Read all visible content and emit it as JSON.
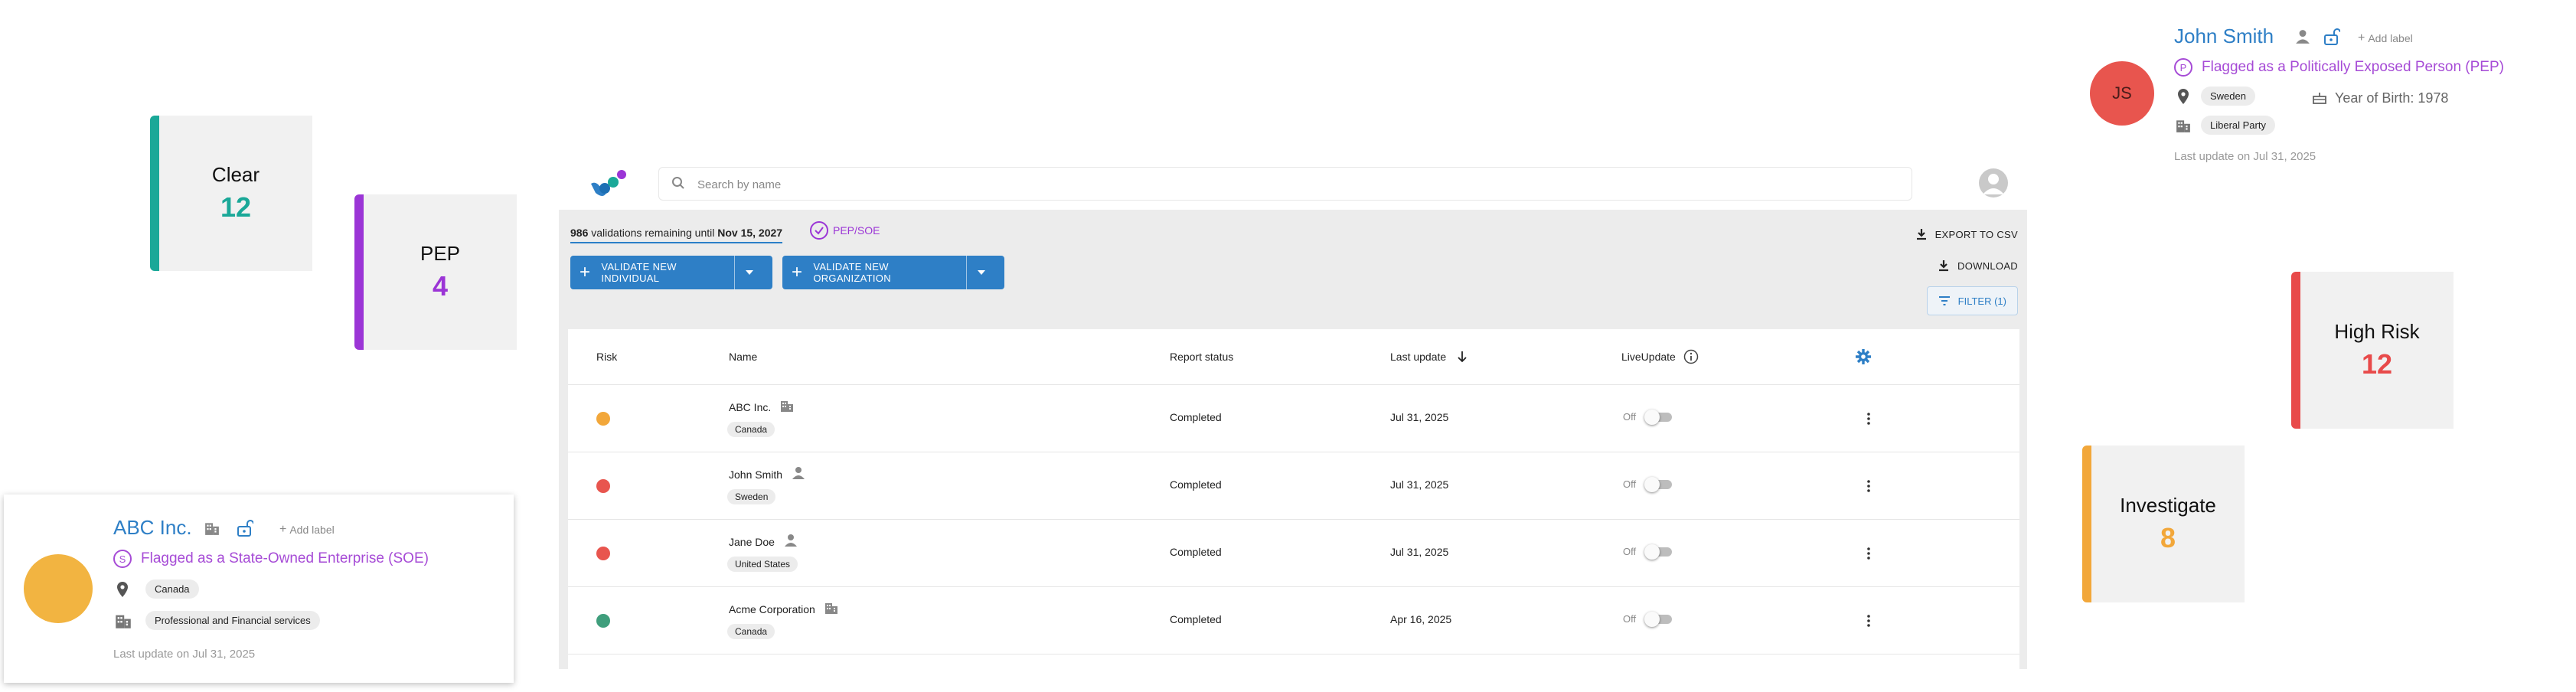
{
  "stats": [
    {
      "label": "Clear",
      "value": "12",
      "color": "#1aa898"
    },
    {
      "label": "PEP",
      "value": "4",
      "color": "#9b35d6"
    },
    {
      "label": "High Risk",
      "value": "12",
      "color": "#e84a4a"
    },
    {
      "label": "Investigate",
      "value": "8",
      "color": "#f2a73a"
    }
  ],
  "topbar": {
    "search_placeholder": "Search by name"
  },
  "toolbar": {
    "remaining_count": "986",
    "remaining_text": " validations remaining until ",
    "remaining_date": "Nov 15, 2027",
    "pep_soe": "PEP/SOE",
    "validate_individual": "VALIDATE NEW INDIVIDUAL",
    "validate_organization": "VALIDATE NEW ORGANIZATION",
    "export_csv": "EXPORT TO CSV",
    "download": "DOWNLOAD",
    "filter": "FILTER (1)"
  },
  "table": {
    "headers": {
      "risk": "Risk",
      "name": "Name",
      "report_status": "Report status",
      "last_update": "Last update",
      "live_update": "LiveUpdate"
    },
    "rows": [
      {
        "risk_color": "#f2a73a",
        "name": "ABC Inc.",
        "type_icon": "building-icon",
        "country": "Canada",
        "status": "Completed",
        "date": "Jul 31, 2025",
        "live": "Off"
      },
      {
        "risk_color": "#e8554e",
        "name": "John Smith",
        "type_icon": "person-icon",
        "country": "Sweden",
        "status": "Completed",
        "date": "Jul 31, 2025",
        "live": "Off"
      },
      {
        "risk_color": "#e8554e",
        "name": "Jane Doe",
        "type_icon": "person-icon",
        "country": "United States",
        "status": "Completed",
        "date": "Jul 31, 2025",
        "live": "Off"
      },
      {
        "risk_color": "#3f9e7c",
        "name": "Acme Corporation",
        "type_icon": "building-icon",
        "country": "Canada",
        "status": "Completed",
        "date": "Apr 16, 2025",
        "live": "Off"
      }
    ]
  },
  "john_card": {
    "initials": "JS",
    "avatar_color": "#e8554e",
    "name": "John Smith",
    "add_label": "Add label",
    "flag_letter": "P",
    "flag_text": "Flagged as a Politically Exposed Person (PEP)",
    "country": "Sweden",
    "year_of_birth": "Year of Birth: 1978",
    "party": "Liberal Party",
    "last_update": "Last update on Jul 31, 2025"
  },
  "abc_card": {
    "avatar_color": "#f2b441",
    "name": "ABC Inc.",
    "add_label": "Add label",
    "flag_letter": "S",
    "flag_text": "Flagged as a State-Owned Enterprise (SOE)",
    "country": "Canada",
    "industry": "Professional and Financial services",
    "last_update": "Last update on Jul 31, 2025"
  }
}
